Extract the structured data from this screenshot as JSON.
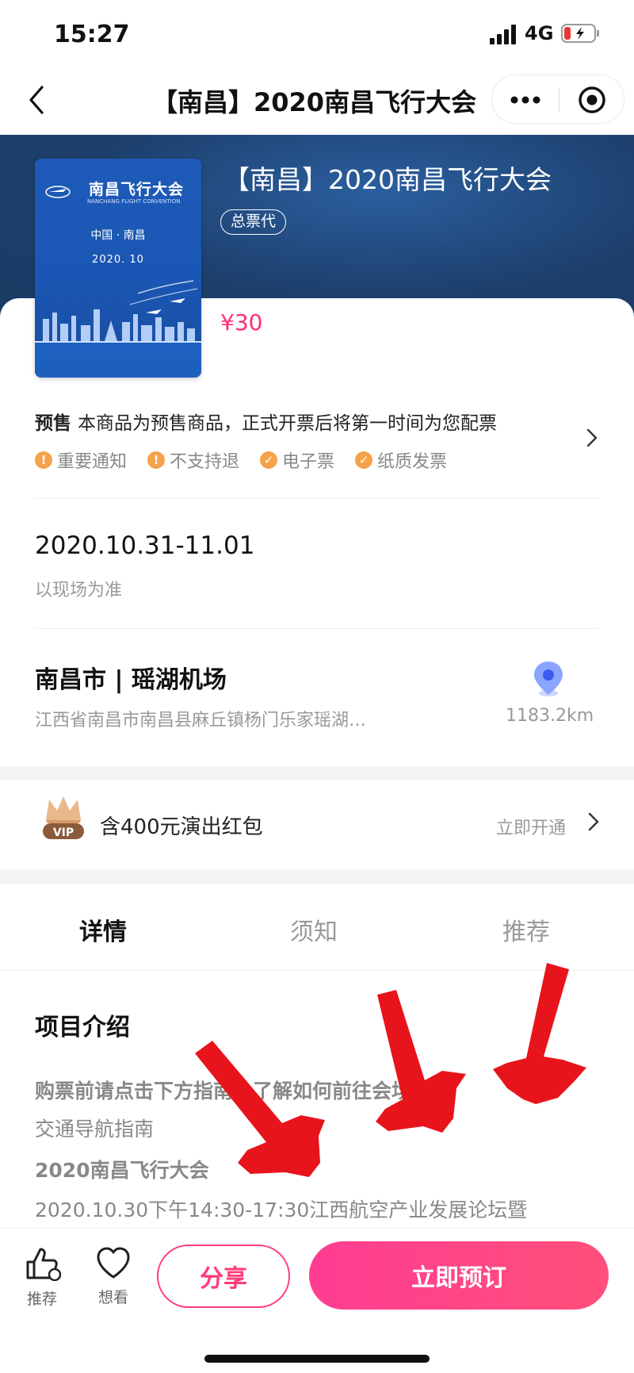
{
  "status_bar": {
    "time": "15:27",
    "network": "4G"
  },
  "nav": {
    "title": "【南昌】2020南昌飞行大会"
  },
  "poster": {
    "title": "南昌飞行大会",
    "subtitle": "NANCHANG FLIGHT CONVENTION",
    "city": "中国 · 南昌",
    "date": "2020. 10"
  },
  "event": {
    "title": "【南昌】2020南昌飞行大会",
    "badge": "总票代",
    "price": "¥30"
  },
  "presale": {
    "label": "预售",
    "text": "本商品为预售商品，正式开票后将第一时间为您配票",
    "tags": [
      "重要通知",
      "不支持退",
      "电子票",
      "纸质发票"
    ]
  },
  "date": {
    "range": "2020.10.31-11.01",
    "note": "以现场为准"
  },
  "venue": {
    "name": "南昌市 | 瑶湖机场",
    "address": "江西省南昌市南昌县麻丘镇杨门乐家瑶湖…",
    "distance": "1183.2km"
  },
  "vip": {
    "badge": "VIP",
    "text": "含400元演出红包",
    "action": "立即开通"
  },
  "tabs": [
    "详情",
    "须知",
    "推荐"
  ],
  "detail": {
    "section_title": "项目介绍",
    "lines": [
      "购票前请点击下方指南，了解如何前往会场",
      "交通导航指南",
      "2020南昌飞行大会",
      "2020.10.30下午14:30-17:30江西航空产业发展论坛暨"
    ]
  },
  "bottom_bar": {
    "like_label": "推荐",
    "want_label": "想看",
    "share_label": "分享",
    "buy_label": "立即预订"
  },
  "colors": {
    "accent": "#ff3d77",
    "hero": "#1d3f6c",
    "tag": "#f6a24a",
    "annotation_arrow": "#e8141c"
  }
}
